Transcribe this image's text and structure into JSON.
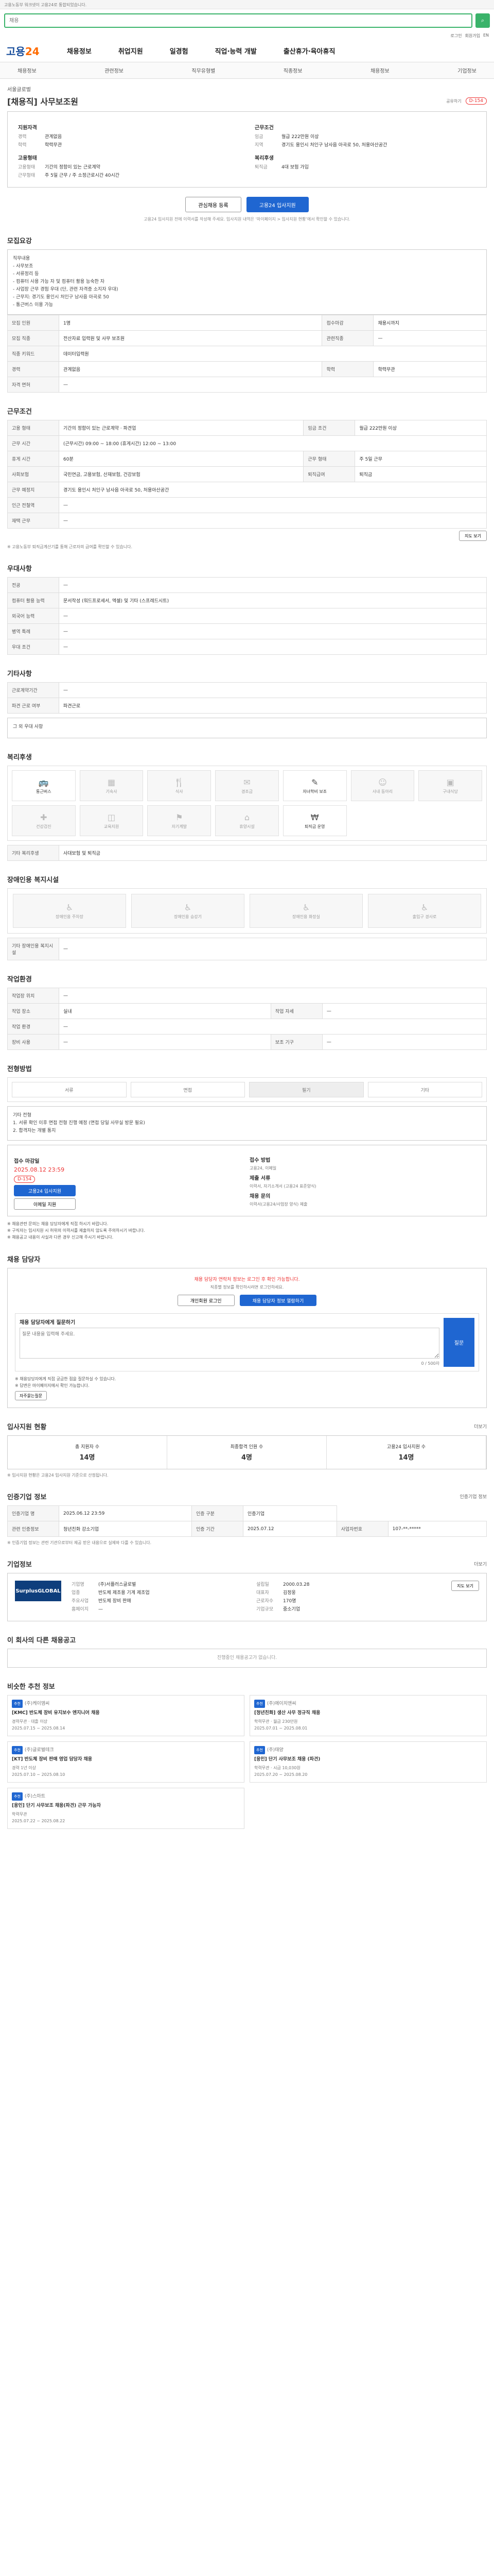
{
  "topbar": {
    "notice": "고용노동부 워크넷이 고용24로 통합되었습니다."
  },
  "search": {
    "placeholder": "채용"
  },
  "util": [
    "로그인",
    "회원가입",
    "EN"
  ],
  "header": {
    "logo_a": "고용",
    "logo_b": "24",
    "menu": [
      "채용정보",
      "취업지원",
      "일경험",
      "직업·능력 개발",
      "출산휴가·육아휴직"
    ]
  },
  "lnb": [
    "채용정보",
    "관련정보",
    "직무유형별",
    "직종정보",
    "채용정보",
    "기업정보"
  ],
  "job": {
    "company": "서울글로벌",
    "title": "[채용직] 사무보조원",
    "share": "공유하기",
    "dday": "D-154",
    "left_title": "지원자격",
    "left_rows": [
      {
        "k": "경력",
        "v": "관계없음"
      },
      {
        "k": "학력",
        "v": "학력무관"
      }
    ],
    "left_title2": "고용형태",
    "left_rows2": [
      {
        "k": "고용형태",
        "v": "기간의 정함이 있는 근로계약"
      },
      {
        "k": "근무형태",
        "v": "주 5일 근무 / 주 소정근로시간 40시간"
      }
    ],
    "right_title": "근무조건",
    "right_rows": [
      {
        "k": "임금",
        "v": "월급 222만원 이상"
      },
      {
        "k": "지역",
        "v": "경기도 용인시 처인구 남사읍 아곡로 50, 처용아산공간"
      }
    ],
    "right_title2": "복리후생",
    "right_rows2": [
      {
        "k": "퇴직금",
        "v": "4대 보험 가입"
      }
    ],
    "btn_save": "관심채용 등록",
    "btn_apply": "고용24 입사지원",
    "notice": "고용24 입사지원 전에 이력서를 작성해 주세요. 입사지원 내역은 ‘마이페이지 > 입사지원 현황’에서 확인할 수 있습니다."
  },
  "sections": {
    "detail": "모집요강",
    "cond": "근무조건",
    "pref": "우대사항",
    "etc": "기타사항",
    "welfare": "복리후생",
    "disabled": "장애인용 복지시설",
    "work": "작업환경",
    "support": "전형방법",
    "qna": "채용 담당자",
    "stat": "입사지원 현황",
    "info": "인증기업 정보",
    "company": "기업정보",
    "others": "이 회사의 다른 채용공고",
    "rec": "비슷한 추천 정보"
  },
  "detail": {
    "text": "직무내용\n - 사무보조\n - 서류정리 등\n - 컴퓨터 사용 가능 자 및 컴퓨터 활용 능숙한 자\n - 사업장 근무 경험 우대 (단, 관련 자격증 소지자 우대)\n - 근무지: 경기도 용인시 처인구 남사읍 아곡로 50\n - 통근버스 이용 가능",
    "rows": [
      {
        "k": "모집 인원",
        "v": "1명",
        "k2": "접수마감",
        "v2": "채용시까지"
      },
      {
        "k": "모집 직종",
        "v": "전산자료 입력원 및 사무 보조원",
        "k2": "관련직종",
        "v2": "—"
      },
      {
        "k": "직종 키워드",
        "v": "데이터입력원",
        "k2": "",
        "v2": ""
      },
      {
        "k": "경력",
        "v": "관계없음",
        "k2": "학력",
        "v2": "학력무관"
      },
      {
        "k": "자격 면허",
        "v": "—",
        "k2": "",
        "v2": ""
      }
    ]
  },
  "cond": {
    "rows": [
      {
        "k": "고용 형태",
        "v": "기간의 정함이 있는 근로계약 · 파견업",
        "k2": "임금 조건",
        "v2": "월급 222만원 이상"
      },
      {
        "k": "근무 시간",
        "v": "(근무시간) 09:00 ~ 18:00 (휴게시간) 12:00 ~ 13:00",
        "k2": "",
        "v2": ""
      },
      {
        "k": "휴게 시간",
        "v": "60분",
        "k2": "근무 형태",
        "v2": "주 5일 근무"
      },
      {
        "k": "사회보험",
        "v": "국민연금, 고용보험, 산재보험, 건강보험",
        "k2": "퇴직급여",
        "v2": "퇴직금"
      },
      {
        "k": "근무 예정지",
        "v": "경기도 용인시 처인구 남사읍 아곡로 50, 처용아산공간",
        "k2": "",
        "v2": ""
      },
      {
        "k": "인근 전철역",
        "v": "—",
        "k2": "",
        "v2": ""
      },
      {
        "k": "재택 근무",
        "v": "—",
        "k2": "",
        "v2": ""
      }
    ],
    "map_btn": "지도 보기",
    "foot": "※ 고용노동부 퇴직금계산기를 통해 근로자의 급여를 확인할 수 있습니다."
  },
  "pref": {
    "rows": [
      {
        "k": "전공",
        "v": "—"
      },
      {
        "k": "컴퓨터 활용 능력",
        "v": "문서작성 (워드프로세서, 엑셀) 및 기타 (스프레드시트)"
      },
      {
        "k": "외국어 능력",
        "v": "—"
      },
      {
        "k": "병역 특례",
        "v": "—"
      },
      {
        "k": "우대 조건",
        "v": "—"
      }
    ]
  },
  "etc": {
    "rows": [
      {
        "k": "근로계약기간",
        "v": "—"
      },
      {
        "k": "파견 근로 여부",
        "v": "파견근로"
      }
    ],
    "box": "그 외 우대 사항"
  },
  "welfare": {
    "items": [
      "통근버스",
      "기숙사",
      "식사",
      "경조금",
      "자녀학비 보조",
      "사내 동아리",
      "구내식당",
      "건강검진",
      "교육지원",
      "자기계발",
      "휴양시설",
      "퇴직금 운영"
    ],
    "glyphs": [
      "🚌",
      "▦",
      "🍴",
      "✉",
      "✎",
      "☺",
      "▣",
      "✚",
      "◫",
      "⚑",
      "⌂",
      "₩"
    ],
    "on": [
      0,
      4,
      11
    ],
    "extra_title": "기타 복리후생",
    "extra": "사대보험 및 퇴직금"
  },
  "disabled": {
    "items": [
      "장애인용 주차장",
      "장애인용 승강기",
      "장애인용 화장실",
      "출입구 경사로"
    ],
    "foot_title": "기타 장애인용 복지시설",
    "foot": "—"
  },
  "work": {
    "rows": [
      {
        "k": "작업장 위치",
        "v": "—",
        "k2": "",
        "v2": ""
      },
      {
        "k": "작업 장소",
        "v": "실내",
        "k2": "작업 자세",
        "v2": "—"
      },
      {
        "k": "작업 환경",
        "v": "—",
        "k2": "",
        "v2": ""
      },
      {
        "k": "장비 사용",
        "v": "—",
        "k2": "보조 기구",
        "v2": "—"
      }
    ]
  },
  "support": {
    "items": [
      "서류",
      "면접",
      "필기",
      "기타"
    ],
    "on": 2,
    "text": "기타 전형\n 1. 서류 확인 이후 면접 전형 진행 예정 (면접 당일 사무실 방문 필요)\n 2. 합격자는 개별 통지",
    "apply_title": "접수 마감일",
    "apply_date": "2025.08.12 23:59",
    "apply_dday": "D-154",
    "apply_btn": "고용24 입사지원",
    "apply_btn2": "이메일 지원",
    "doc_title": "제출 서류",
    "doc": "이력서, 자기소개서 (고용24 표준양식)",
    "method_title": "접수 방법",
    "method": "고용24, 이메일",
    "contact_title": "채용 문의",
    "contact": "이력서(고용24/사업장 양식) 제출",
    "list": [
      "※ 채용관련 문의는 채용 담당자에게 직접 하시기 바랍니다.",
      "※ 구직자는 입사지원 시 허위의 이력서를 제출하지 않도록 주의하시기 바랍니다.",
      "※ 채용공고 내용이 사실과 다른 경우 신고해 주시기 바랍니다."
    ]
  },
  "qna": {
    "note1": "채용 담당자 연락처 정보는 로그인 후 확인 가능합니다.",
    "note2": "직종별 정보를 확인하시려면 로그인하세요.",
    "btn1": "개인회원 로그인",
    "btn2": "채용 담당자 정보 열람하기",
    "form_title": "채용 담당자에게 질문하기",
    "form_placeholder": "질문 내용을 입력해 주세요.",
    "form_count": "0 / 500자",
    "form_btn": "질문",
    "list": [
      "※ 채용담당자에게 직접 궁금한 점을 질문하실 수 있습니다.",
      "※ 답변은 마이페이지에서 확인 가능합니다."
    ],
    "btn_faq": "자주묻는질문"
  },
  "stat": {
    "more": "더보기",
    "items": [
      {
        "k": "총 지원자 수",
        "v": "14명"
      },
      {
        "k": "최종합격 인원 수",
        "v": "4명"
      },
      {
        "k": "고용24 입사지원 수",
        "v": "14명"
      }
    ],
    "foot": "※ 입사지원 현황은 고용24 입사지원 기준으로 산정됩니다."
  },
  "info": {
    "more": "인증기업 정보",
    "rows": [
      {
        "k": "인증기업 명",
        "v": "2025.06.12 23:59",
        "k2": "인증 구분",
        "v2": "인증기업",
        "k3": "",
        "v3": ""
      },
      {
        "k": "관련 인증정보",
        "v": "청년친화 강소기업",
        "k2": "인증 기간",
        "v2": "2025.07.12",
        "k3": "사업자번호",
        "v3": "107-**-*****"
      }
    ],
    "foot": "※ 인증기업 정보는 관련 기관으로부터 제공 받은 내용으로 실제와 다를 수 있습니다."
  },
  "company": {
    "more": "더보기",
    "logo": "SurplusGLOBAL",
    "rows": [
      {
        "k": "기업명",
        "v": "(주)서플러스글로벌"
      },
      {
        "k": "설립일",
        "v": "2000.03.28"
      },
      {
        "k": "업종",
        "v": "반도체 제조용 기계 제조업"
      },
      {
        "k": "대표자",
        "v": "김정웅"
      },
      {
        "k": "주요사업",
        "v": "반도체 장비 판매"
      },
      {
        "k": "근로자수",
        "v": "170명"
      },
      {
        "k": "홈페이지",
        "v": "—"
      },
      {
        "k": "기업규모",
        "v": "중소기업"
      }
    ],
    "map": "지도 보기"
  },
  "others": {
    "empty": "진행중인 채용공고가 없습니다."
  },
  "rec": [
    {
      "badge": "추천",
      "company": "(주)케이엠씨",
      "title": "[KMC] 반도체 장비 유지보수 엔지니어 채용",
      "cond": "경력무관 · 대졸 이상",
      "date": "2025.07.15 ~ 2025.08.14"
    },
    {
      "badge": "추천",
      "company": "(주)에이치앤씨",
      "title": "[청년친화] 생산 사무 정규직 채용",
      "cond": "학력무관 · 월급 230만원",
      "date": "2025.07.01 ~ 2025.08.01"
    },
    {
      "badge": "추천",
      "company": "(주)글로벌테크",
      "title": "[KT] 반도체 장비 판매 영업 담당자 채용",
      "cond": "경력 1년 이상",
      "date": "2025.07.10 ~ 2025.08.10"
    },
    {
      "badge": "추천",
      "company": "(주)태양",
      "title": "[용인] 단기 사무보조 채용 (파견)",
      "cond": "학력무관 · 시급 10,030원",
      "date": "2025.07.20 ~ 2025.08.20"
    },
    {
      "badge": "추천",
      "company": "(주)스마트",
      "title": "[용인] 단기 사무보조 채용(파견) 근무 가능자",
      "cond": "학력무관",
      "date": "2025.07.22 ~ 2025.08.22"
    }
  ]
}
